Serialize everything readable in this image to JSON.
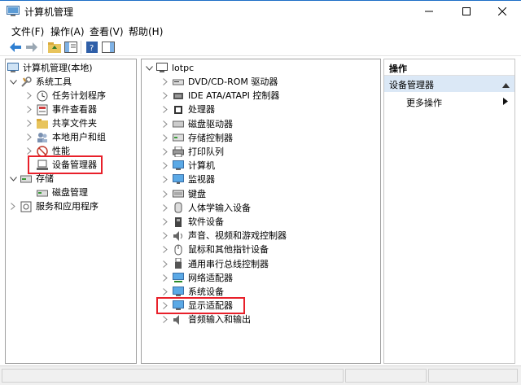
{
  "window": {
    "title": "计算机管理",
    "buttons": [
      "minimize",
      "maximize",
      "close"
    ]
  },
  "menu": {
    "items": [
      "文件(F)",
      "操作(A)",
      "查看(V)",
      "帮助(H)"
    ]
  },
  "toolbar": {
    "buttons": [
      "back-arrow-icon",
      "forward-arrow-icon",
      "up-folder-icon",
      "show-tree-icon",
      "help-icon",
      "show-action-pane-icon"
    ]
  },
  "left_tree": {
    "root": "计算机管理(本地)",
    "system_tools": "系统工具",
    "task_scheduler": "任务计划程序",
    "event_viewer": "事件查看器",
    "shared_folders": "共享文件夹",
    "local_users": "本地用户和组",
    "performance": "性能",
    "device_manager": "设备管理器",
    "storage": "存储",
    "disk_management": "磁盘管理",
    "services_apps": "服务和应用程序"
  },
  "device_tree": {
    "root": "lotpc",
    "categories": [
      "DVD/CD-ROM 驱动器",
      "IDE ATA/ATAPI 控制器",
      "处理器",
      "磁盘驱动器",
      "存储控制器",
      "打印队列",
      "计算机",
      "监视器",
      "键盘",
      "人体学输入设备",
      "软件设备",
      "声音、视频和游戏控制器",
      "鼠标和其他指针设备",
      "通用串行总线控制器",
      "网络适配器",
      "系统设备",
      "显示适配器",
      "音频输入和输出"
    ]
  },
  "actions": {
    "header": "操作",
    "section": "设备管理器",
    "more": "更多操作"
  },
  "colors": {
    "highlight_border": "#e8202a",
    "title_accent": "#1d6fc6",
    "selected_section_bg": "#dbe8f6"
  }
}
